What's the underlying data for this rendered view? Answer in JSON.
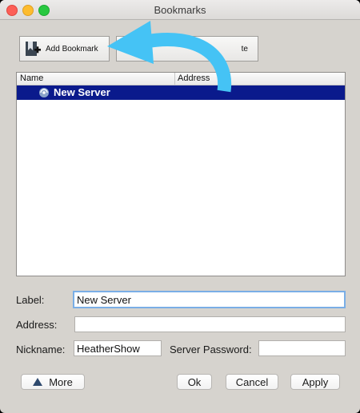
{
  "window": {
    "title": "Bookmarks"
  },
  "toolbar": {
    "add_bookmark_label": "Add Bookmark",
    "delete_label_visible_fragment": "te"
  },
  "list": {
    "columns": [
      "Name",
      "Address"
    ],
    "rows": [
      {
        "name": "New Server",
        "address": ""
      }
    ],
    "selected_index": 0
  },
  "form": {
    "label_label": "Label:",
    "label_value": "New Server",
    "address_label": "Address:",
    "address_value": "",
    "nickname_label": "Nickname:",
    "nickname_value": "HeatherShow",
    "server_password_label": "Server Password:",
    "server_password_value": ""
  },
  "buttons": {
    "more": "More",
    "ok": "Ok",
    "cancel": "Cancel",
    "apply": "Apply"
  },
  "colors": {
    "selection": "#0a1a8c",
    "arrow": "#45c3f5",
    "focus_ring": "#7aaee6"
  }
}
